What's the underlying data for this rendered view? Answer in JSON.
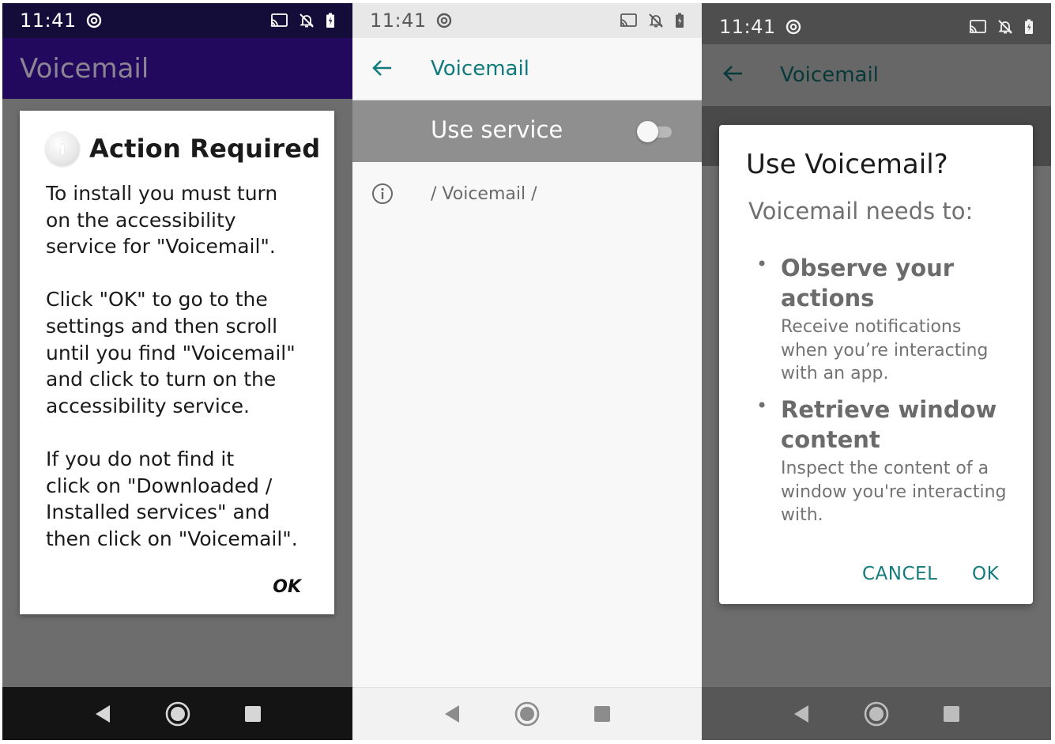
{
  "status_bar": {
    "time": "11:41"
  },
  "screen1": {
    "app_title": "Voicemail",
    "dialog": {
      "title": "Action Required",
      "paragraphs": [
        "To install you must turn\non the accessibility\nservice for \"Voicemail\".",
        "Click \"OK\" to go to the\nsettings and then scroll\nuntil you find \"Voicemail\"\nand click to turn on the\naccessibility service.",
        "If you do not find it\nclick on \"Downloaded /\nInstalled services\" and\nthen click on \"Voicemail\"."
      ],
      "ok_label": "OK"
    }
  },
  "screen2": {
    "title": "Voicemail",
    "use_service_label": "Use service",
    "use_service_on": false,
    "info_path": "/ Voicemail /"
  },
  "screen3": {
    "title": "Voicemail",
    "dialog": {
      "title": "Use Voicemail?",
      "subtitle": "Voicemail needs to:",
      "permissions": [
        {
          "title": "Observe your\nactions",
          "description": "Receive notifications\nwhen you’re interacting\nwith an app."
        },
        {
          "title": "Retrieve window\ncontent",
          "description": "Inspect the content of a\nwindow you're interacting\nwith."
        }
      ],
      "cancel_label": "CANCEL",
      "ok_label": "OK"
    }
  },
  "colors": {
    "accent_teal": "#117a7c",
    "appbar_purple": "#22095e",
    "statusbar_purple": "#140d3a"
  }
}
